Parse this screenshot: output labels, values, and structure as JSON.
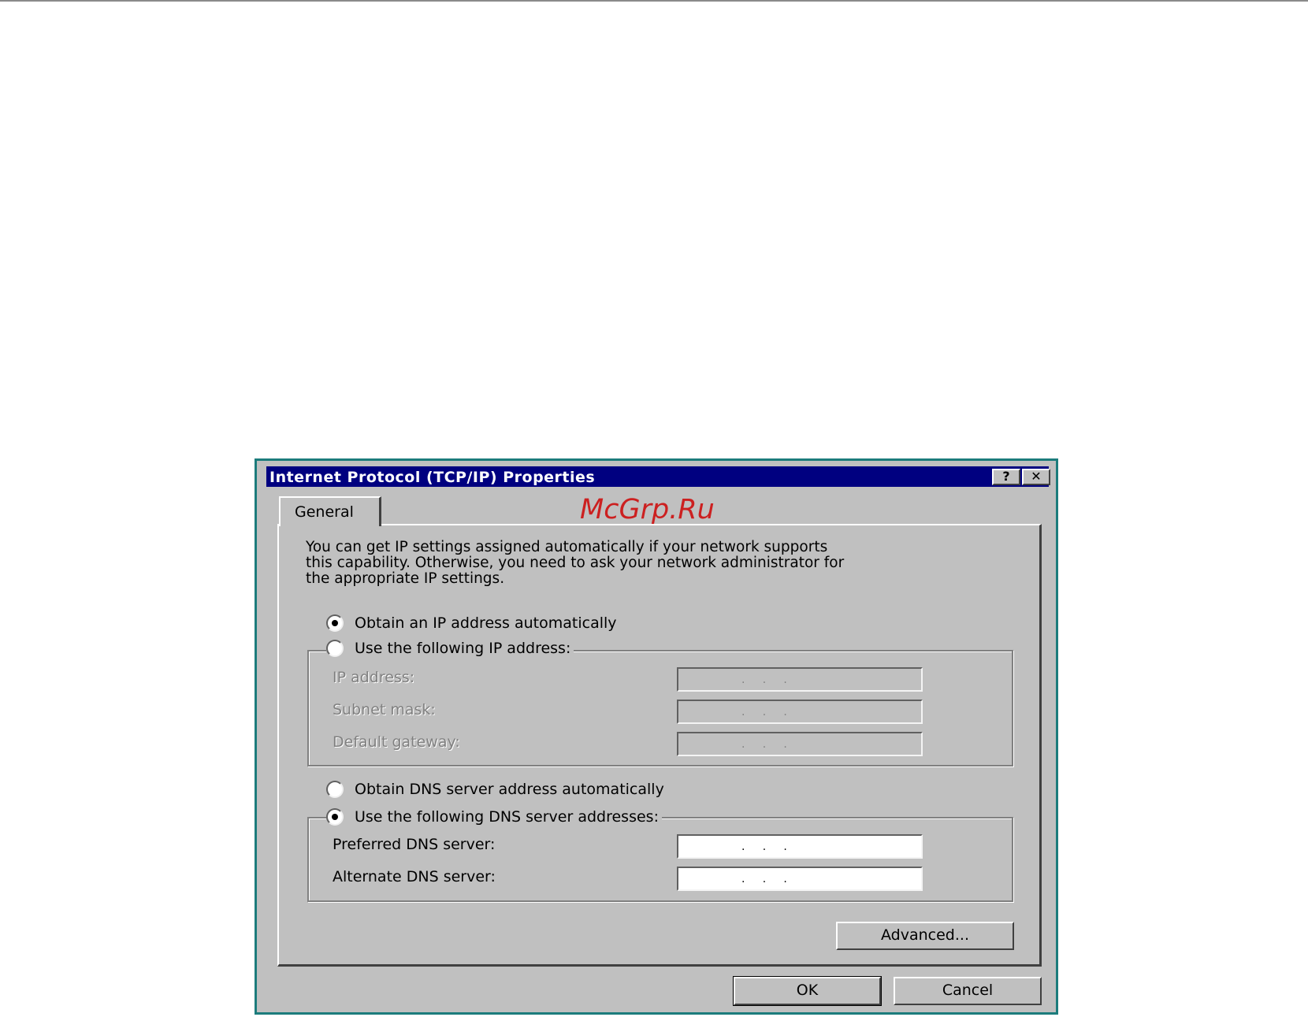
{
  "dialog": {
    "title": "Internet Protocol (TCP/IP) Properties",
    "help_button": "?",
    "close_button": "✕",
    "tab_general": "General",
    "watermark": "McGrp.Ru",
    "intro_text": "You can get IP settings assigned automatically if your network supports\nthis capability. Otherwise, you need to ask your network administrator for\nthe appropriate IP settings."
  },
  "ip_section": {
    "obtain_auto": {
      "label": "Obtain an IP address automatically",
      "checked": true
    },
    "use_following": {
      "label": "Use the following IP address:",
      "checked": false
    },
    "fields": [
      {
        "label": "IP address:",
        "value": ".     .     ."
      },
      {
        "label": "Subnet mask:",
        "value": ".     .     ."
      },
      {
        "label": "Default gateway:",
        "value": ".     .     ."
      }
    ]
  },
  "dns_section": {
    "obtain_auto": {
      "label": "Obtain DNS server address automatically",
      "checked": false
    },
    "use_following": {
      "label": "Use the following DNS server addresses:",
      "checked": true
    },
    "fields": [
      {
        "label": "Preferred DNS server:",
        "value": ".     .     ."
      },
      {
        "label": "Alternate DNS server:",
        "value": ".     .     ."
      }
    ]
  },
  "buttons": {
    "advanced": "Advanced...",
    "ok": "OK",
    "cancel": "Cancel"
  },
  "icons": {
    "help": "help-icon",
    "close": "close-icon",
    "radio_checked": "radio-checked-icon",
    "radio_unchecked": "radio-unchecked-icon"
  }
}
